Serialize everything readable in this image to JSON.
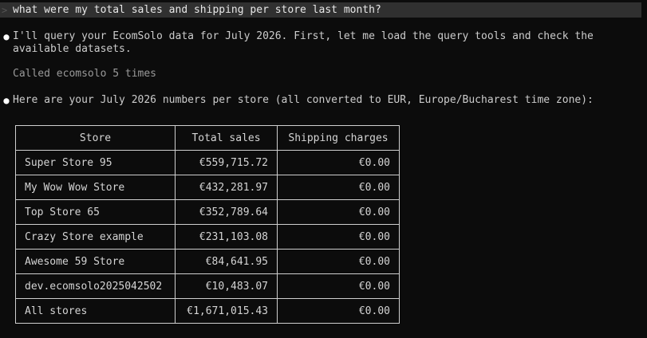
{
  "prompt": {
    "marker": ">",
    "text": "what were my total sales and shipping per store last month?"
  },
  "messages": [
    {
      "bullet": "●",
      "text": "I'll query your EcomSolo data for July 2026. First, let me load the query tools and check the\navailable datasets."
    },
    {
      "bullet": "●",
      "text": "Here are your July 2026 numbers per store (all converted to EUR, Europe/Bucharest time zone):"
    }
  ],
  "tool_call": "Called ecomsolo 5 times",
  "table": {
    "headers": [
      "Store",
      "Total sales",
      "Shipping charges"
    ],
    "rows": [
      [
        "Super Store 95",
        "€559,715.72",
        "€0.00"
      ],
      [
        "My Wow Wow Store",
        "€432,281.97",
        "€0.00"
      ],
      [
        "Top Store 65",
        "€352,789.64",
        "€0.00"
      ],
      [
        "Crazy Store example",
        "€231,103.08",
        "€0.00"
      ],
      [
        "Awesome 59 Store",
        "€84,641.95",
        "€0.00"
      ],
      [
        "dev.ecomsolo2025042502",
        "€10,483.07",
        "€0.00"
      ],
      [
        "All stores",
        "€1,671,015.43",
        "€0.00"
      ]
    ]
  }
}
